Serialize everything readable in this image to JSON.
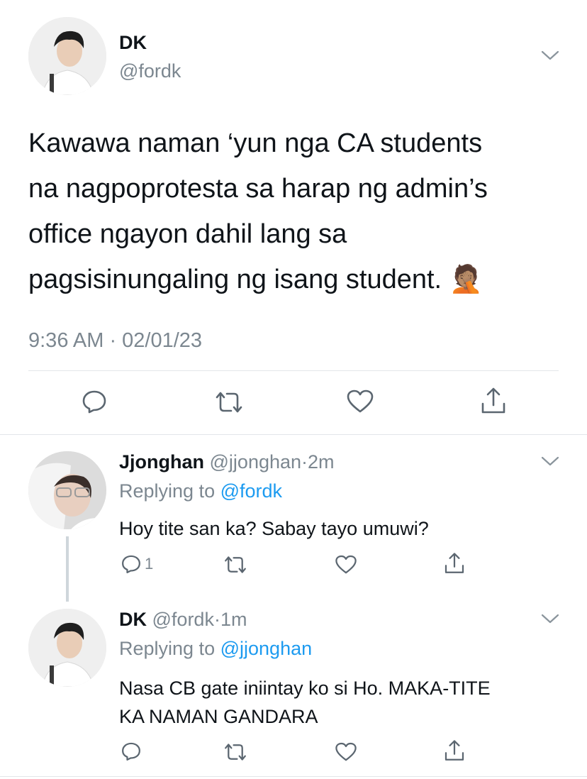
{
  "main_tweet": {
    "display_name": "DK",
    "handle": "@fordk",
    "text_lines": [
      "Kawawa naman ‘yun nga CA students",
      "na nagpoprotesta sa harap ng admin’s",
      "office ngayon dahil lang sa",
      "pagsisinungaling ng isang student."
    ],
    "emoji": "🤦🏽",
    "timestamp": "9:36 AM · 02/01/23",
    "actions": [
      "reply-icon",
      "retweet-icon",
      "like-icon",
      "share-icon"
    ]
  },
  "replies": [
    {
      "display_name": "Jjonghan",
      "handle": "@jjonghan",
      "separator": "·",
      "time": "2m",
      "replying_prefix": "Replying to",
      "replying_handle": "@fordk",
      "text_lines": [
        "Hoy tite san ka? Sabay tayo umuwi?"
      ],
      "reply_count": "1"
    },
    {
      "display_name": "DK",
      "handle": "@fordk",
      "separator": "·",
      "time": "1m",
      "replying_prefix": "Replying to",
      "replying_handle": "@jjonghan",
      "text_lines": [
        "Nasa CB gate iniintay ko si Ho. MAKA-TITE",
        "KA NAMAN GANDARA"
      ],
      "reply_count": ""
    }
  ],
  "colors": {
    "text": "#0f1419",
    "secondary": "#7c8790",
    "link": "#1d9bf0",
    "divider": "#e3e6e9"
  }
}
